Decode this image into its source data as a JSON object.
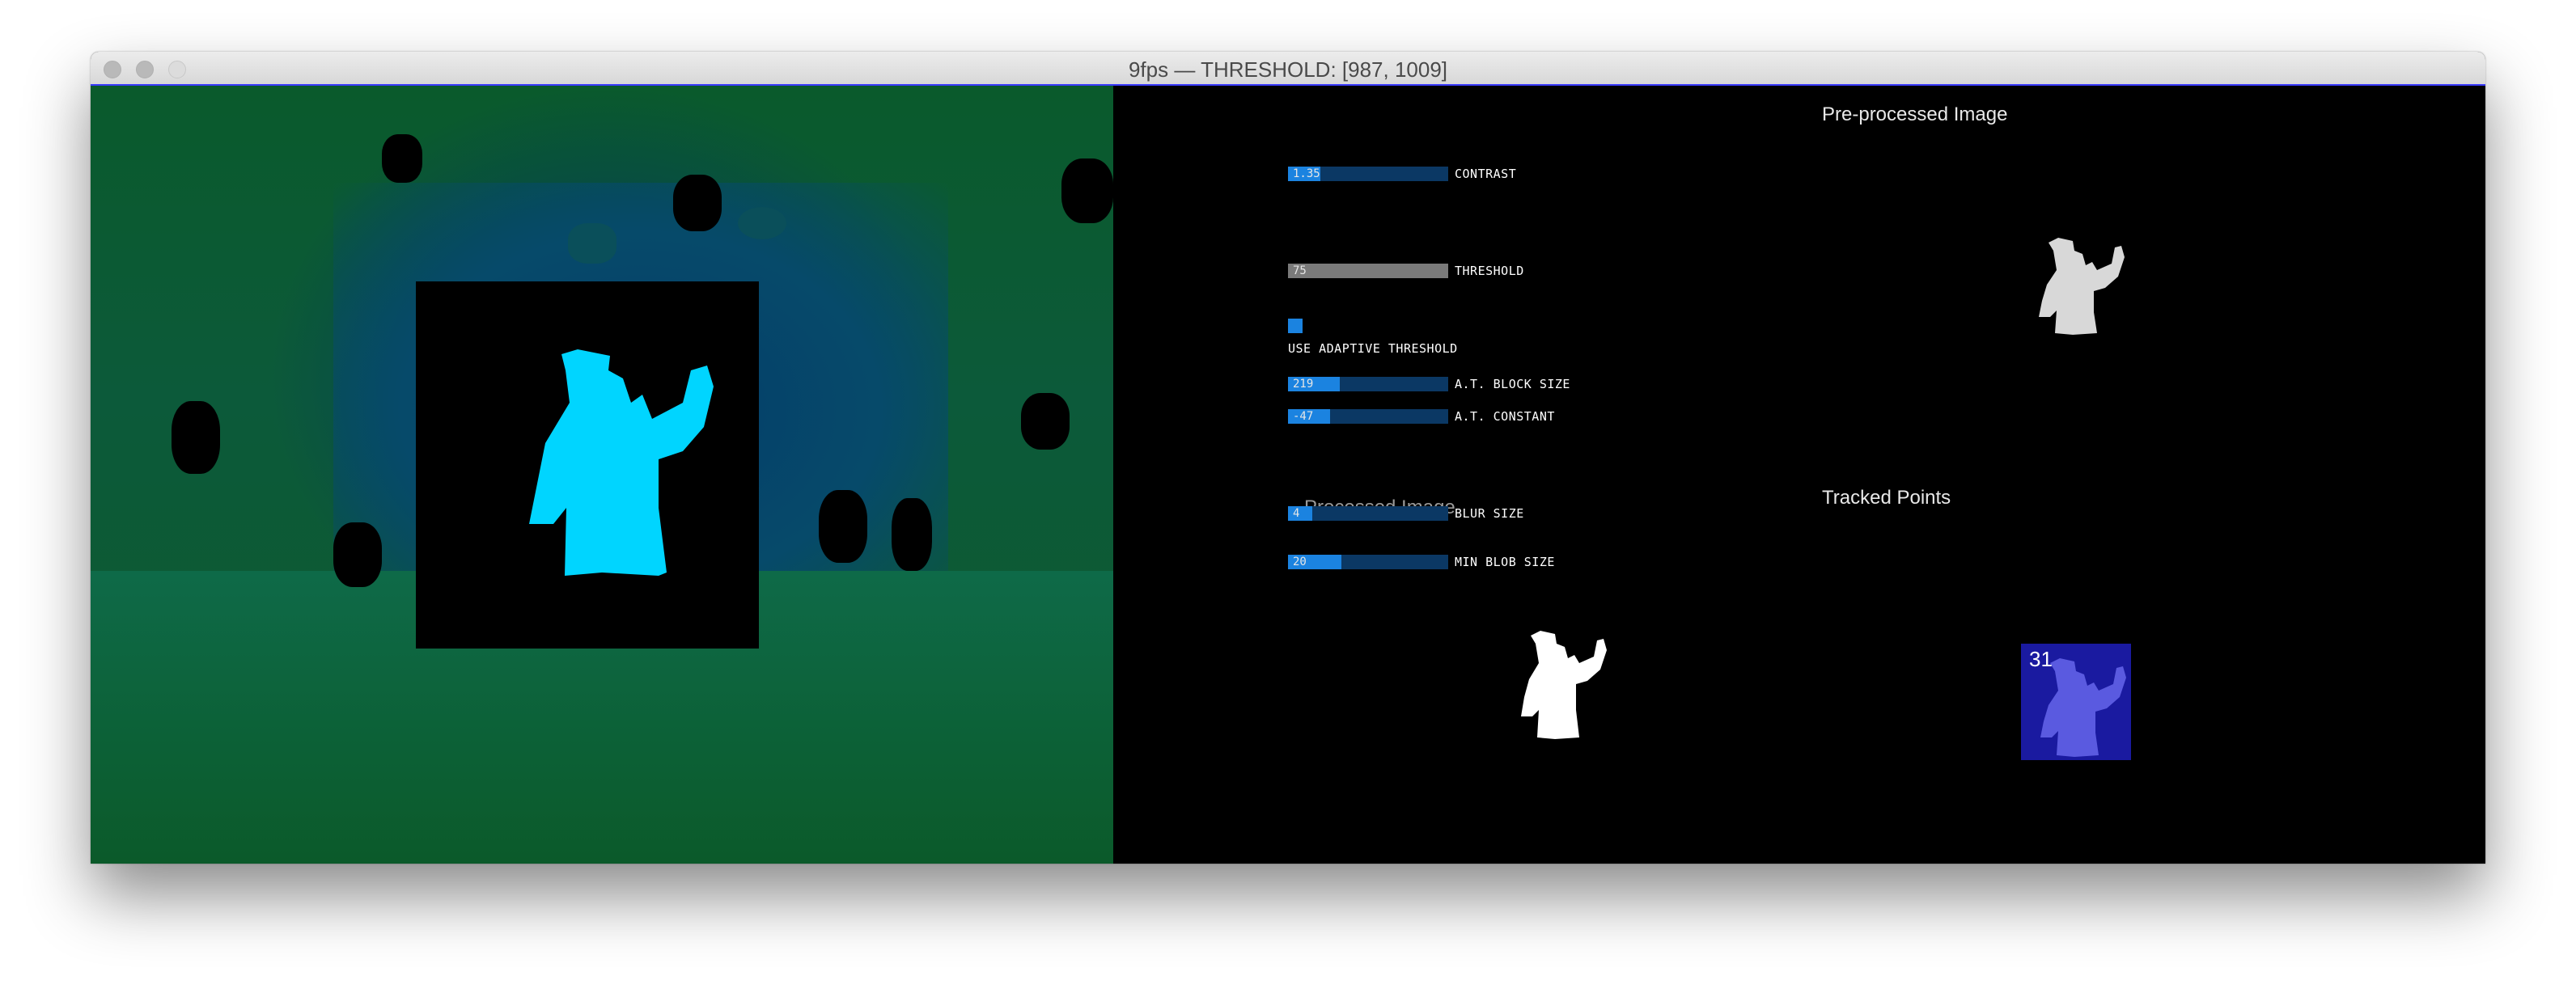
{
  "window": {
    "title": "9fps — THRESHOLD: [987, 1009]"
  },
  "controls": {
    "contrast": {
      "value": "1.35",
      "label": "CONTRAST",
      "fraction": 0.2
    },
    "threshold": {
      "value": "75",
      "label": "THRESHOLD",
      "fraction": 1.0
    },
    "adaptive": {
      "label": "USE ADAPTIVE THRESHOLD",
      "checked": true
    },
    "block_size": {
      "value": "219",
      "label": "A.T. BLOCK SIZE",
      "fraction": 0.32
    },
    "constant": {
      "value": "-47",
      "label": "A.T. CONSTANT",
      "fraction": 0.26
    },
    "blur_size": {
      "value": "4",
      "label": "BLUR SIZE",
      "fraction": 0.15
    },
    "min_blob": {
      "value": "20",
      "label": "MIN BLOB SIZE",
      "fraction": 0.33
    }
  },
  "panels": {
    "preprocessed_title": "Pre-processed Image",
    "processed_title": "Processed Image",
    "tracked_title": "Tracked Points",
    "tracked_count": "31"
  },
  "colors": {
    "slider_track": "#0b3864",
    "slider_fill": "#1b83e0",
    "figure_cyan": "#00d5ff",
    "tracked_bg": "#1a1aa0"
  }
}
